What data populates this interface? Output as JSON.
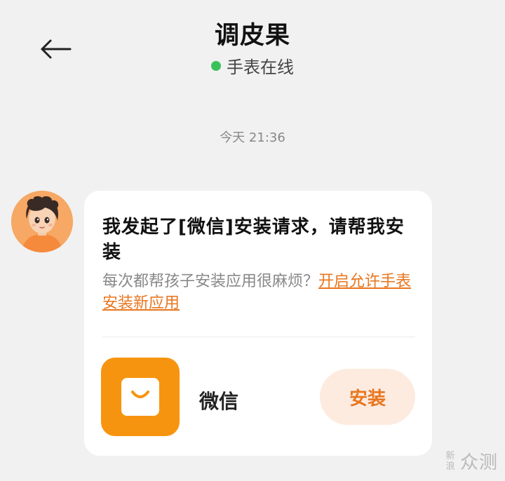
{
  "header": {
    "title": "调皮果",
    "status_text": "手表在线",
    "status_color": "#39c25c",
    "back_icon": "arrow-left-icon"
  },
  "chat": {
    "timestamp": "今天 21:36",
    "message": {
      "title": "我发起了[微信]安装请求，请帮我安装",
      "description_prefix": "每次都帮孩子安装应用很麻烦？",
      "description_link": "开启允许手表安装新应用",
      "app": {
        "name": "微信",
        "icon": "shopping-bag-icon",
        "icon_color": "#f7940f"
      },
      "install_label": "安装",
      "accent_color": "#e8761e"
    }
  },
  "watermark": {
    "small": "新浪",
    "big": "众测"
  }
}
